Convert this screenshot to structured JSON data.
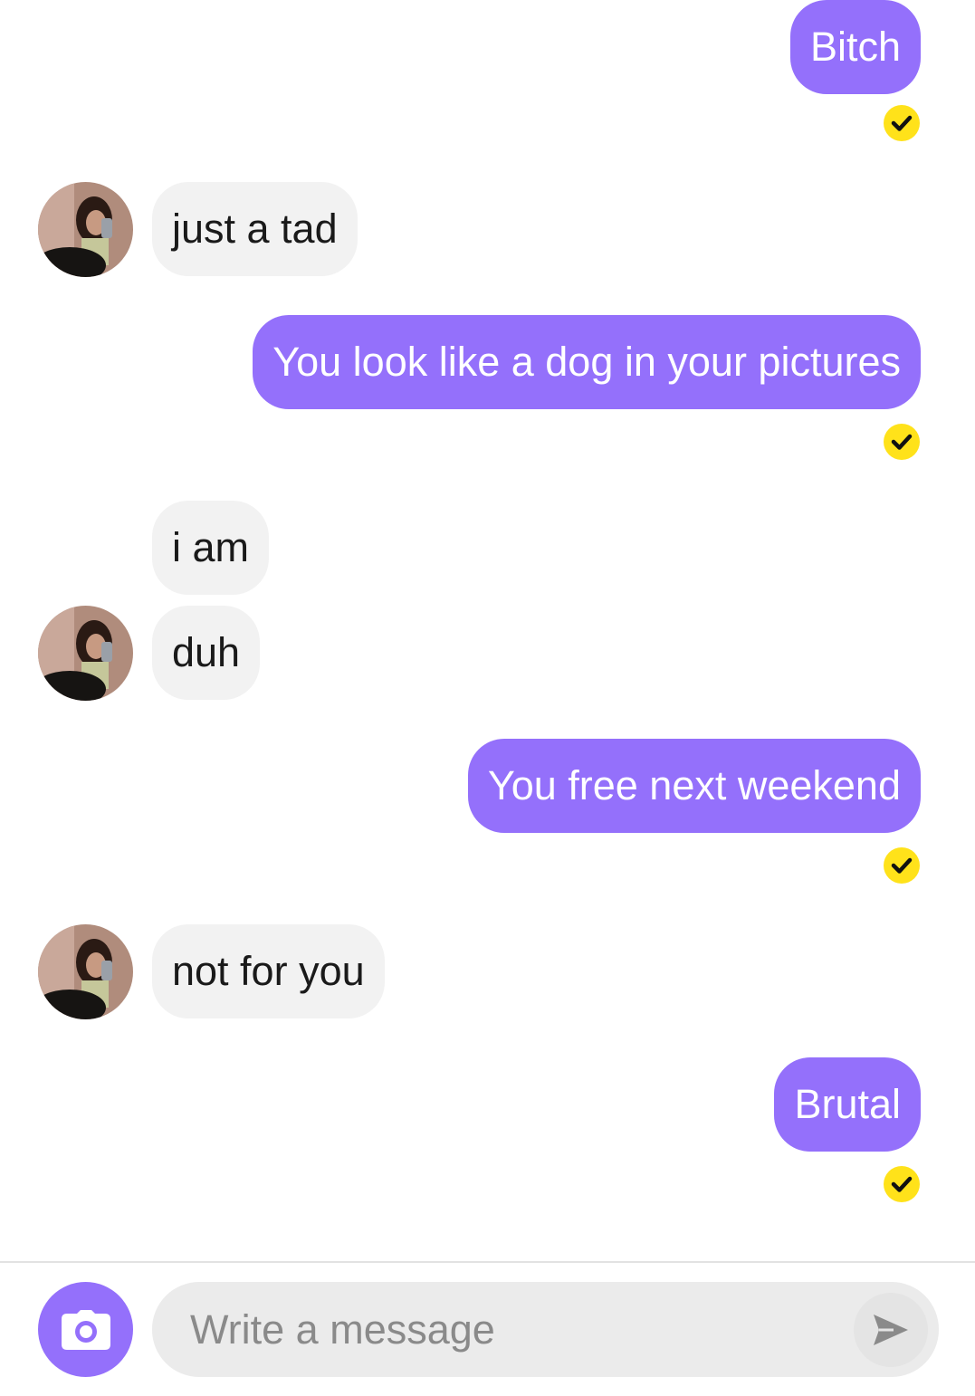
{
  "messages": [
    {
      "id": "m1",
      "direction": "sent",
      "text": "Bitch",
      "read": true
    },
    {
      "id": "m2",
      "direction": "received",
      "text": "just a tad",
      "avatar": true
    },
    {
      "id": "m3",
      "direction": "sent",
      "text": "You look like a dog in your pictures",
      "read": true
    },
    {
      "id": "m4",
      "direction": "received",
      "text": "i am",
      "avatar": false
    },
    {
      "id": "m5",
      "direction": "received",
      "text": "duh",
      "avatar": true
    },
    {
      "id": "m6",
      "direction": "sent",
      "text": "You free next weekend",
      "read": true
    },
    {
      "id": "m7",
      "direction": "received",
      "text": "not for you",
      "avatar": true
    },
    {
      "id": "m8",
      "direction": "sent",
      "text": "Brutal",
      "read": true
    }
  ],
  "composer": {
    "placeholder": "Write a message",
    "value": ""
  },
  "icons": {
    "read_receipt": "check-circle-icon",
    "camera": "camera-icon",
    "send": "send-icon"
  },
  "colors": {
    "sent_bubble": "#9470fb",
    "received_bubble": "#f2f2f2",
    "read_receipt": "#ffe21a",
    "composer_bg": "#ebebeb"
  }
}
